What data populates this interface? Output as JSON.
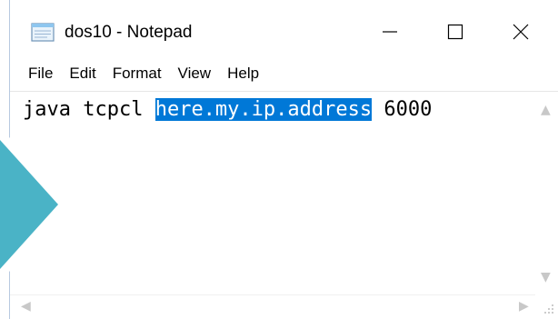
{
  "window": {
    "title": "dos10 - Notepad",
    "accent_color": "#4ab3c6"
  },
  "caption_buttons": {
    "minimize_icon": "minimize-icon",
    "maximize_icon": "maximize-icon",
    "close_icon": "close-icon"
  },
  "menu": {
    "items": [
      "File",
      "Edit",
      "Format",
      "View",
      "Help"
    ]
  },
  "editor": {
    "text_before": "java tcpcl ",
    "text_selected": "here.my.ip.address",
    "text_after": " 6000",
    "selection_color": "#0078d7"
  }
}
